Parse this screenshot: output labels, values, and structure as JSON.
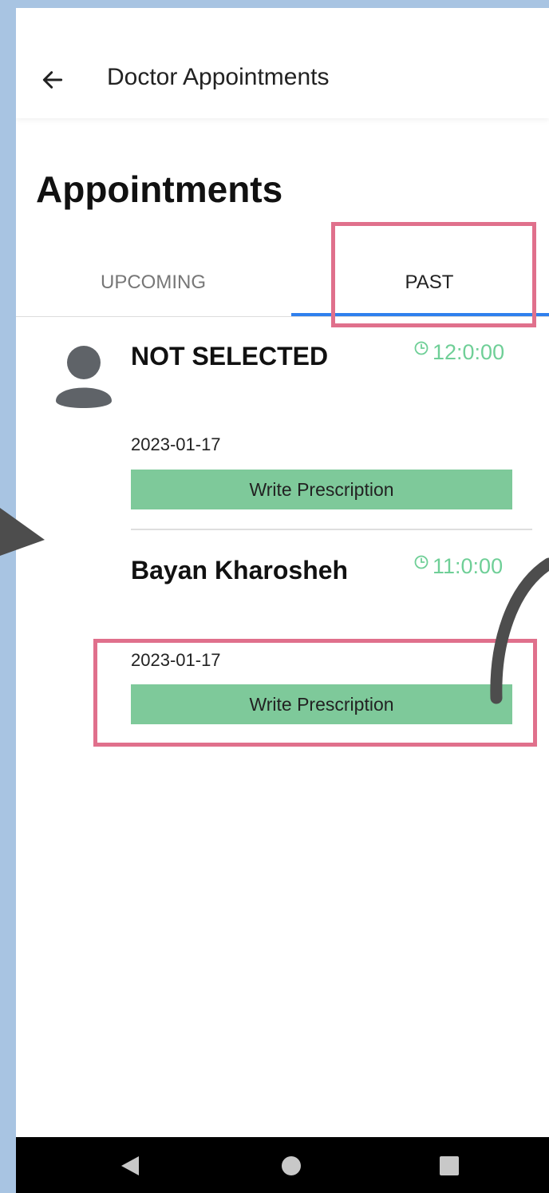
{
  "appbar": {
    "title": "Doctor Appointments"
  },
  "page": {
    "title": "Appointments"
  },
  "tabs": [
    {
      "label": "UPCOMING",
      "active": false
    },
    {
      "label": "PAST",
      "active": true
    }
  ],
  "appointments": [
    {
      "patient": "NOT SELECTED",
      "time": "12:0:00",
      "date": "2023-01-17",
      "action": "Write Prescription"
    },
    {
      "patient": "Bayan Kharosheh",
      "time": "11:0:00",
      "date": "2023-01-17",
      "action": "Write Prescription"
    }
  ],
  "colors": {
    "accent": "#2f80ed",
    "time": "#6fcf97",
    "button": "#7ec99a",
    "annotation": "#e0708c",
    "background": "#a8c4e2"
  },
  "icons": [
    "back-arrow-icon",
    "avatar-icon",
    "clock-icon",
    "nav-back-icon",
    "nav-home-icon",
    "nav-recent-icon"
  ]
}
